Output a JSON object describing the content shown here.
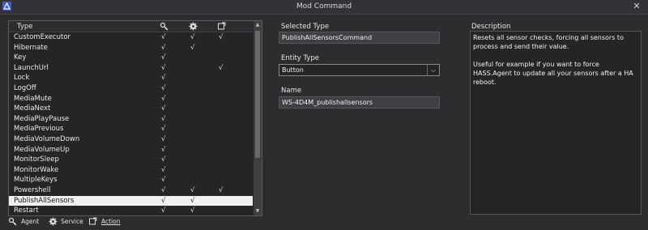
{
  "window": {
    "title": "Mod Command",
    "close_glyph": "✕"
  },
  "table": {
    "columns": {
      "type": "Type",
      "agent_icon": "agent-icon",
      "service_icon": "gear-icon",
      "action_icon": "action-icon"
    },
    "rows": [
      {
        "name": "CustomExecutor",
        "agent": "√",
        "service": "√",
        "action": "√"
      },
      {
        "name": "Hibernate",
        "agent": "√",
        "service": "√",
        "action": ""
      },
      {
        "name": "Key",
        "agent": "√",
        "service": "",
        "action": ""
      },
      {
        "name": "LaunchUrl",
        "agent": "√",
        "service": "",
        "action": "√"
      },
      {
        "name": "Lock",
        "agent": "√",
        "service": "",
        "action": ""
      },
      {
        "name": "LogOff",
        "agent": "√",
        "service": "",
        "action": ""
      },
      {
        "name": "MediaMute",
        "agent": "√",
        "service": "",
        "action": ""
      },
      {
        "name": "MediaNext",
        "agent": "√",
        "service": "",
        "action": ""
      },
      {
        "name": "MediaPlayPause",
        "agent": "√",
        "service": "",
        "action": ""
      },
      {
        "name": "MediaPrevious",
        "agent": "√",
        "service": "",
        "action": ""
      },
      {
        "name": "MediaVolumeDown",
        "agent": "√",
        "service": "",
        "action": ""
      },
      {
        "name": "MediaVolumeUp",
        "agent": "√",
        "service": "",
        "action": ""
      },
      {
        "name": "MonitorSleep",
        "agent": "√",
        "service": "",
        "action": ""
      },
      {
        "name": "MonitorWake",
        "agent": "√",
        "service": "",
        "action": ""
      },
      {
        "name": "MultipleKeys",
        "agent": "√",
        "service": "",
        "action": ""
      },
      {
        "name": "Powershell",
        "agent": "√",
        "service": "√",
        "action": "√"
      },
      {
        "name": "PublishAllSensors",
        "agent": "√",
        "service": "√",
        "action": "",
        "selected": true
      },
      {
        "name": "Restart",
        "agent": "√",
        "service": "√",
        "action": ""
      }
    ]
  },
  "legend": {
    "agent": "Agent",
    "service": "Service",
    "action": "Action"
  },
  "form": {
    "selected_type_label": "Selected Type",
    "selected_type_value": "PublishAllSensorsCommand",
    "entity_type_label": "Entity Type",
    "entity_type_value": "Button",
    "name_label": "Name",
    "name_value": "WS-4D4M_publishallsensors"
  },
  "description": {
    "label": "Description",
    "paragraph1": "Resets all sensor checks, forcing all sensors to process and send their value.",
    "paragraph2": "Useful for example if you want to force HASS.Agent to update all your sensors after a HA reboot."
  },
  "colors": {
    "background": "#2d2d30",
    "selected_row": "#f0f0f0",
    "field": "#3f3f46"
  }
}
